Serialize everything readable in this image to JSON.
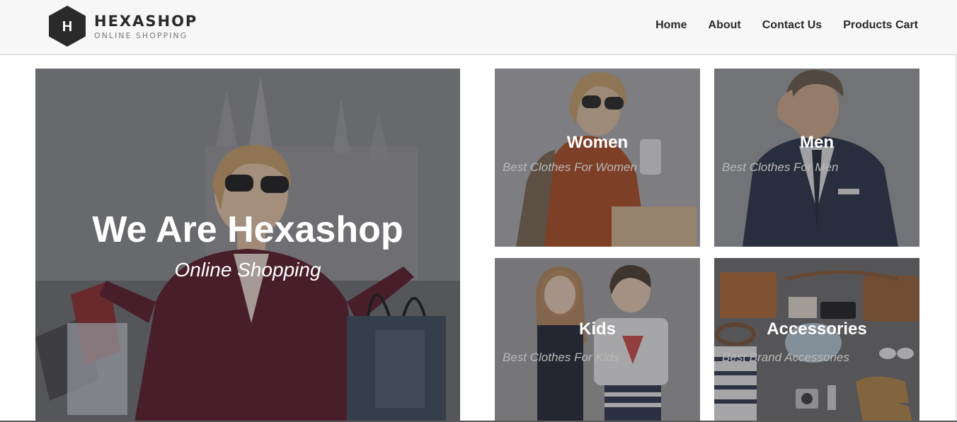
{
  "logo": {
    "letter": "H",
    "name": "HEXASHOP",
    "tagline": "ONLINE SHOPPING"
  },
  "nav": {
    "items": [
      "Home",
      "About",
      "Contact Us",
      "Products Cart"
    ]
  },
  "hero": {
    "title": "We Are Hexashop",
    "subtitle": "Online Shopping"
  },
  "categories": [
    {
      "title": "Women",
      "subtitle": "Best Clothes For Women"
    },
    {
      "title": "Men",
      "subtitle": "Best Clothes For Men"
    },
    {
      "title": "Kids",
      "subtitle": "Best Clothes For Kids"
    },
    {
      "title": "Accessories",
      "subtitle": "Best Brand Accessories"
    }
  ],
  "colors": {
    "header_bg": "#f7f7f7",
    "logo_hex": "#2a2a2a",
    "text_dark": "#2a2a2a",
    "overlay_text": "#ffffff"
  }
}
